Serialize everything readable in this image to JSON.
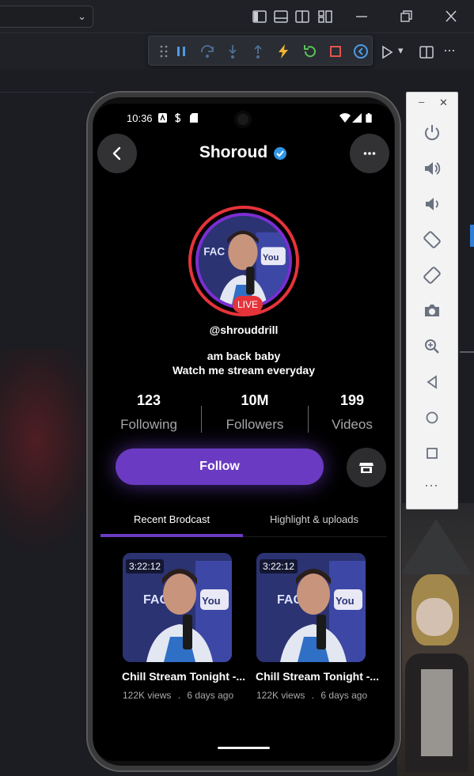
{
  "ide": {
    "debug_toolbar": [
      "drag-handle",
      "pause",
      "step-over",
      "step-into",
      "step-out",
      "hot-reload",
      "hot-restart",
      "stop",
      "devtools"
    ],
    "run_chevron": "▾",
    "dropdown_chevron": "⌄",
    "more": "···"
  },
  "emulator": {
    "minimize": "–",
    "close": "✕",
    "more": "···"
  },
  "phone": {
    "status_time": "10:36"
  },
  "profile": {
    "name": "Shoroud",
    "handle": "@shrouddrill",
    "live_label": "LIVE",
    "bio_line1": "am back baby",
    "bio_line2": "Watch me stream everyday",
    "stats": [
      {
        "value": "123",
        "label": "Following"
      },
      {
        "value": "10M",
        "label": "Followers"
      },
      {
        "value": "199",
        "label": "Videos"
      }
    ],
    "follow_label": "Follow"
  },
  "tabs": {
    "recent": "Recent Brodcast",
    "highlights": "Highlight & uploads",
    "active": "recent"
  },
  "videos": [
    {
      "duration": "3:22:12",
      "title": "Chill Stream Tonight -...",
      "views": "122K views",
      "dot": ".",
      "age": "6 days ago"
    },
    {
      "duration": "3:22:12",
      "title": "Chill Stream Tonight -...",
      "views": "122K views",
      "dot": ".",
      "age": "6 days ago"
    }
  ],
  "colors": {
    "accent_purple": "#6a3bc2",
    "live_red": "#e5333a",
    "verified_blue": "#2f95e8"
  }
}
